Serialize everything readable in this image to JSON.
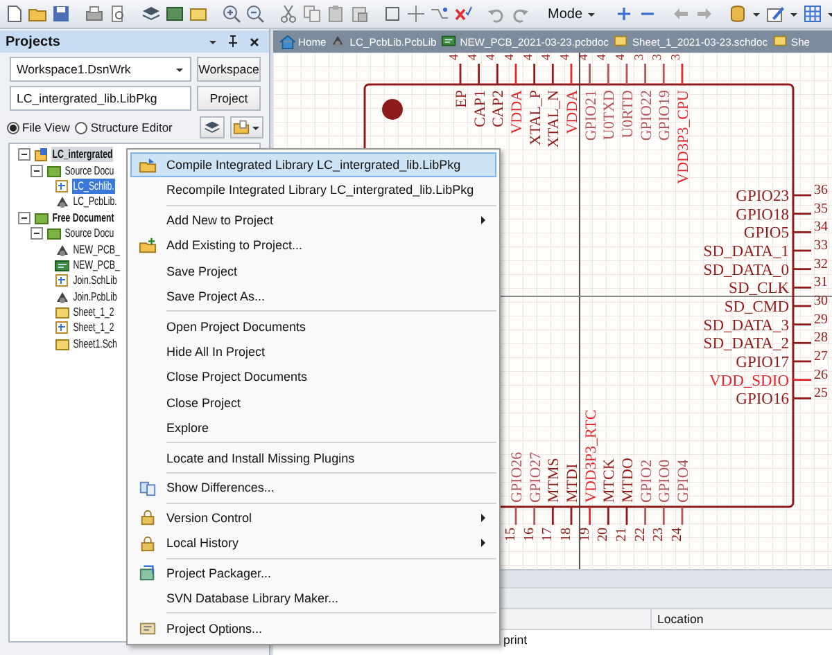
{
  "toolbar": {
    "mode": "Mode"
  },
  "projects_panel": {
    "title": "Projects",
    "workspace": "Workspace1.DsnWrk",
    "workspace_button": "Workspace",
    "project": "LC_intergrated_lib.LibPkg",
    "project_button": "Project",
    "views": [
      {
        "label": "File View",
        "selected": true
      },
      {
        "label": "Structure Editor",
        "selected": false
      }
    ],
    "tree": [
      {
        "label": "LC_intergrated",
        "kind": "project",
        "selected": false,
        "active": true,
        "expanded": true,
        "children": [
          {
            "label": "Source Docu",
            "kind": "folder",
            "selected": false,
            "expanded": true,
            "children": [
              {
                "label": "LC_Schlib.",
                "kind": "schlib",
                "selected": true
              },
              {
                "label": "LC_PcbLib.",
                "kind": "pcblib",
                "selected": false
              }
            ]
          }
        ]
      },
      {
        "label": "Free Document",
        "kind": "folder",
        "selected": false,
        "active": false,
        "expanded": true,
        "children": [
          {
            "label": "Source Docu",
            "kind": "folder",
            "selected": false,
            "expanded": true,
            "children": [
              {
                "label": "NEW_PCB_",
                "kind": "pcblib",
                "selected": false
              },
              {
                "label": "NEW_PCB_",
                "kind": "pcbdoc",
                "selected": false
              },
              {
                "label": "Join.SchLib",
                "kind": "schlib",
                "selected": false
              },
              {
                "label": "Join.PcbLib",
                "kind": "pcblib",
                "selected": false
              },
              {
                "label": "Sheet_1_2",
                "kind": "schdoc",
                "selected": false
              },
              {
                "label": "Sheet_1_2",
                "kind": "schlib",
                "selected": false
              },
              {
                "label": "Sheet1.Sch",
                "kind": "schdoc",
                "selected": false
              }
            ]
          }
        ]
      }
    ]
  },
  "document_tabs": [
    {
      "label": "Home",
      "kind": "home"
    },
    {
      "label": "LC_PcbLib.PcbLib",
      "kind": "pcblib"
    },
    {
      "label": "NEW_PCB_2021-03-23.pcbdoc",
      "kind": "pcbdoc"
    },
    {
      "label": "Sheet_1_2021-03-23.schdoc",
      "kind": "schdoc"
    },
    {
      "label": "She",
      "kind": "schdoc"
    }
  ],
  "schematic": {
    "top_pins": [
      {
        "number": "4",
        "name": "EP",
        "color": "#8e1b1b"
      },
      {
        "number": "4",
        "name": "CAP1",
        "color": "#8e1b1b"
      },
      {
        "number": "4",
        "name": "CAP2",
        "color": "#8e1b1b"
      },
      {
        "number": "4",
        "name": "VDDA",
        "color": "#e3262e"
      },
      {
        "number": "4",
        "name": "XTAL_P",
        "color": "#8e1b1b"
      },
      {
        "number": "4",
        "name": "XTAL_N",
        "color": "#8e1b1b"
      },
      {
        "number": "4",
        "name": "VDDA",
        "color": "#e3262e"
      },
      {
        "number": "4",
        "name": "GPIO21",
        "color": "#b4545a"
      },
      {
        "number": "4",
        "name": "U0TXD",
        "color": "#b4545a"
      },
      {
        "number": "4",
        "name": "U0RTD",
        "color": "#b4545a"
      },
      {
        "number": "3",
        "name": "GPIO22",
        "color": "#b4545a"
      },
      {
        "number": "3",
        "name": "GPIO19",
        "color": "#b4545a"
      },
      {
        "number": "3",
        "name": "VDD3P3_CPU",
        "color": "#e3262e"
      }
    ],
    "right_pins": [
      {
        "number": "36",
        "name": "GPIO23",
        "color": "#8e1b1b"
      },
      {
        "number": "35",
        "name": "GPIO18",
        "color": "#8e1b1b"
      },
      {
        "number": "34",
        "name": "GPIO5",
        "color": "#8e1b1b"
      },
      {
        "number": "33",
        "name": "SD_DATA_1",
        "color": "#8e1b1b"
      },
      {
        "number": "32",
        "name": "SD_DATA_0",
        "color": "#8e1b1b"
      },
      {
        "number": "31",
        "name": "SD_CLK",
        "color": "#8e1b1b"
      },
      {
        "number": "30",
        "name": "SD_CMD",
        "color": "#8e1b1b"
      },
      {
        "number": "29",
        "name": "SD_DATA_3",
        "color": "#8e1b1b"
      },
      {
        "number": "28",
        "name": "SD_DATA_2",
        "color": "#8e1b1b"
      },
      {
        "number": "27",
        "name": "GPIO17",
        "color": "#8e1b1b"
      },
      {
        "number": "26",
        "name": "VDD_SDIO",
        "color": "#e3262e"
      },
      {
        "number": "25",
        "name": "GPIO16",
        "color": "#8e1b1b"
      }
    ],
    "bottom_pins": [
      {
        "number": "15",
        "name": "GPIO26",
        "color": "#b4545a"
      },
      {
        "number": "16",
        "name": "GPIO27",
        "color": "#b4545a"
      },
      {
        "number": "17",
        "name": "MTMS",
        "color": "#8e1b1b"
      },
      {
        "number": "18",
        "name": "MTDI",
        "color": "#8e1b1b"
      },
      {
        "number": "19",
        "name": "VDD3P3_RTC",
        "color": "#e3262e"
      },
      {
        "number": "20",
        "name": "MTCK",
        "color": "#8e1b1b"
      },
      {
        "number": "21",
        "name": "MTDO",
        "color": "#8e1b1b"
      },
      {
        "number": "22",
        "name": "GPIO2",
        "color": "#b4545a"
      },
      {
        "number": "23",
        "name": "GPIO0",
        "color": "#b4545a"
      },
      {
        "number": "24",
        "name": "GPIO4",
        "color": "#b4545a"
      }
    ]
  },
  "bottom_panel": {
    "columns": [
      "Location"
    ],
    "cell": "print"
  },
  "context_menu": [
    {
      "kind": "compile",
      "label": "Compile Integrated Library LC_intergrated_lib.LibPkg",
      "submenu": false,
      "selected": true
    },
    {
      "kind": "plain",
      "label": "Recompile Integrated Library LC_intergrated_lib.LibPkg",
      "submenu": false,
      "selected": false
    },
    {
      "kind": "separator"
    },
    {
      "kind": "plain",
      "label": "Add New to Project",
      "submenu": true,
      "selected": false
    },
    {
      "kind": "add",
      "label": "Add Existing to Project...",
      "submenu": false,
      "selected": false
    },
    {
      "kind": "plain",
      "label": "Save Project",
      "submenu": false,
      "selected": false
    },
    {
      "kind": "plain",
      "label": "Save Project As...",
      "submenu": false,
      "selected": false
    },
    {
      "kind": "separator"
    },
    {
      "kind": "plain",
      "label": "Open Project Documents",
      "submenu": false,
      "selected": false
    },
    {
      "kind": "plain",
      "label": "Hide All In Project",
      "submenu": false,
      "selected": false
    },
    {
      "kind": "plain",
      "label": "Close Project Documents",
      "submenu": false,
      "selected": false
    },
    {
      "kind": "plain",
      "label": "Close Project",
      "submenu": false,
      "selected": false
    },
    {
      "kind": "plain",
      "label": "Explore",
      "submenu": false,
      "selected": false
    },
    {
      "kind": "separator"
    },
    {
      "kind": "plain",
      "label": "Locate and Install Missing Plugins",
      "submenu": false,
      "selected": false
    },
    {
      "kind": "separator"
    },
    {
      "kind": "diff",
      "label": "Show Differences...",
      "submenu": false,
      "selected": false
    },
    {
      "kind": "separator"
    },
    {
      "kind": "lock",
      "label": "Version Control",
      "submenu": true,
      "selected": false
    },
    {
      "kind": "lock",
      "label": "Local History",
      "submenu": true,
      "selected": false
    },
    {
      "kind": "separator"
    },
    {
      "kind": "package",
      "label": "Project Packager...",
      "submenu": false,
      "selected": false
    },
    {
      "kind": "plain",
      "label": "SVN Database Library Maker...",
      "submenu": false,
      "selected": false
    },
    {
      "kind": "separator"
    },
    {
      "kind": "options",
      "label": "Project Options...",
      "submenu": false,
      "selected": false
    }
  ]
}
